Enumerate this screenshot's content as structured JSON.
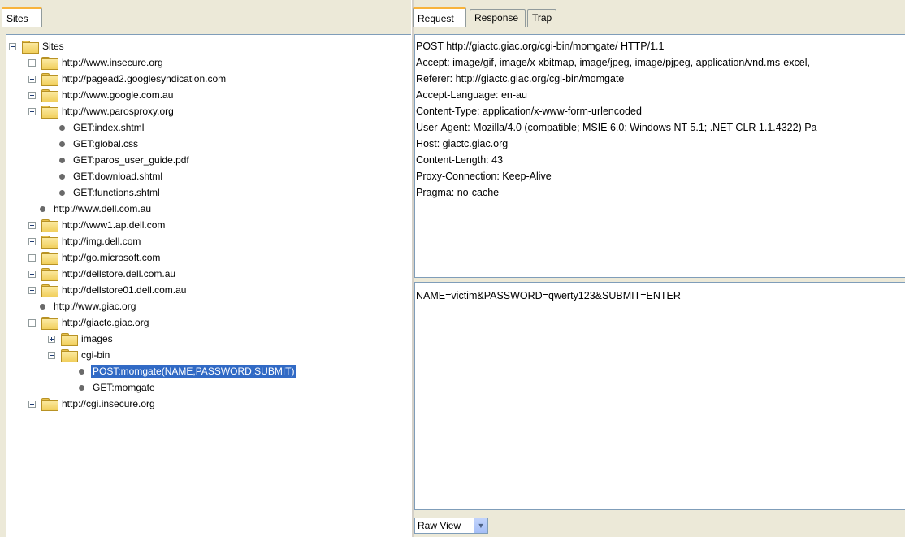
{
  "left": {
    "tab_label": "Sites"
  },
  "right": {
    "tabs": [
      "Request",
      "Response",
      "Trap"
    ],
    "header_lines": [
      "POST http://giactc.giac.org/cgi-bin/momgate/ HTTP/1.1",
      "Accept: image/gif, image/x-xbitmap, image/jpeg, image/pjpeg, application/vnd.ms-excel,",
      "Referer: http://giactc.giac.org/cgi-bin/momgate",
      "Accept-Language: en-au",
      "Content-Type: application/x-www-form-urlencoded",
      "User-Agent: Mozilla/4.0 (compatible; MSIE 6.0; Windows NT 5.1; .NET CLR 1.1.4322) Pa",
      "Host: giactc.giac.org",
      "Content-Length: 43",
      "Proxy-Connection: Keep-Alive",
      "Pragma: no-cache"
    ],
    "body_text": "NAME=victim&PASSWORD=qwerty123&SUBMIT=ENTER",
    "view_select": "Raw View"
  },
  "tree": [
    {
      "label": "Sites",
      "type": "folder",
      "state": "expanded",
      "depth": 0
    },
    {
      "label": "http://www.insecure.org",
      "type": "folder",
      "state": "collapsed",
      "depth": 1
    },
    {
      "label": "http://pagead2.googlesyndication.com",
      "type": "folder",
      "state": "collapsed",
      "depth": 1
    },
    {
      "label": "http://www.google.com.au",
      "type": "folder",
      "state": "collapsed",
      "depth": 1
    },
    {
      "label": "http://www.parosproxy.org",
      "type": "folder",
      "state": "expanded",
      "depth": 1
    },
    {
      "label": "GET:index.shtml",
      "type": "leaf",
      "depth": 2
    },
    {
      "label": "GET:global.css",
      "type": "leaf",
      "depth": 2
    },
    {
      "label": "GET:paros_user_guide.pdf",
      "type": "leaf",
      "depth": 2
    },
    {
      "label": "GET:download.shtml",
      "type": "leaf",
      "depth": 2
    },
    {
      "label": "GET:functions.shtml",
      "type": "leaf",
      "depth": 2
    },
    {
      "label": "http://www.dell.com.au",
      "type": "leaf",
      "depth": 1
    },
    {
      "label": "http://www1.ap.dell.com",
      "type": "folder",
      "state": "collapsed",
      "depth": 1
    },
    {
      "label": "http://img.dell.com",
      "type": "folder",
      "state": "collapsed",
      "depth": 1
    },
    {
      "label": "http://go.microsoft.com",
      "type": "folder",
      "state": "collapsed",
      "depth": 1
    },
    {
      "label": "http://dellstore.dell.com.au",
      "type": "folder",
      "state": "collapsed",
      "depth": 1
    },
    {
      "label": "http://dellstore01.dell.com.au",
      "type": "folder",
      "state": "collapsed",
      "depth": 1
    },
    {
      "label": "http://www.giac.org",
      "type": "leaf",
      "depth": 1
    },
    {
      "label": "http://giactc.giac.org",
      "type": "folder",
      "state": "expanded",
      "depth": 1
    },
    {
      "label": "images",
      "type": "folder",
      "state": "collapsed",
      "depth": 2
    },
    {
      "label": "cgi-bin",
      "type": "folder",
      "state": "expanded",
      "depth": 2
    },
    {
      "label": "POST:momgate(NAME,PASSWORD,SUBMIT)",
      "type": "leaf",
      "depth": 3,
      "selected": true
    },
    {
      "label": "GET:momgate",
      "type": "leaf",
      "depth": 3
    },
    {
      "label": "http://cgi.insecure.org",
      "type": "folder",
      "state": "collapsed",
      "depth": 1
    }
  ]
}
